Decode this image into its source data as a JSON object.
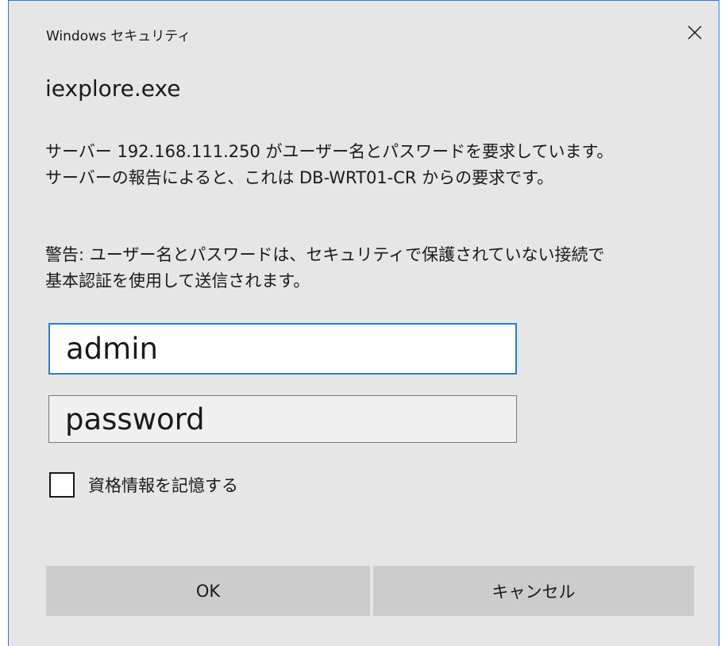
{
  "window": {
    "title": "Windows セキュリティ",
    "close_icon": "close-icon"
  },
  "app_name": "iexplore.exe",
  "message": {
    "server_line1": "サーバー 192.168.111.250 がユーザー名とパスワードを要求しています。",
    "server_line2": "サーバーの報告によると、これは DB-WRT01-CR からの要求です。",
    "warning_line1": "警告: ユーザー名とパスワードは、セキュリティで保護されていない接続で",
    "warning_line2": "基本認証を使用して送信されます。"
  },
  "form": {
    "username_value": "admin",
    "password_placeholder": "password",
    "remember_label": "資格情報を記憶する",
    "remember_checked": false
  },
  "buttons": {
    "ok_label": "OK",
    "cancel_label": "キャンセル"
  },
  "colors": {
    "accent": "#2b7cd3",
    "dialog_bg": "#e6e6e6",
    "button_bg": "#cccccc"
  }
}
